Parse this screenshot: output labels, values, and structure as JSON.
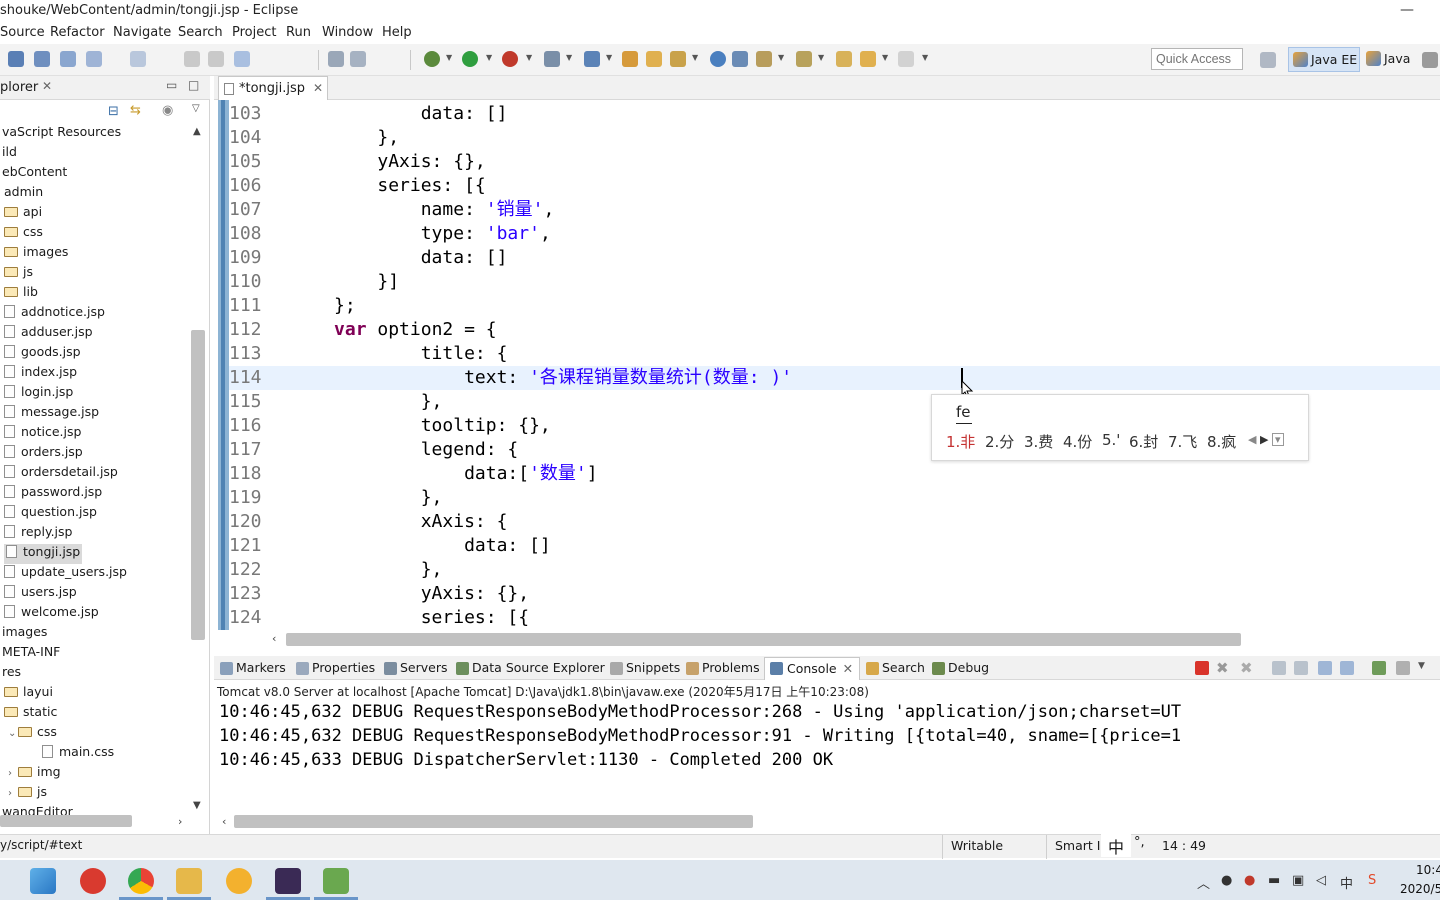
{
  "window": {
    "title": "shouke/WebContent/admin/tongji.jsp - Eclipse",
    "minimize": "—"
  },
  "menu": [
    "Source",
    "Refactor",
    "Navigate",
    "Search",
    "Project",
    "Run",
    "Window",
    "Help"
  ],
  "toolbar": {
    "quick_access_placeholder": "Quick Access",
    "perspective_javaee": "Java EE",
    "perspective_java": "Java"
  },
  "explorer": {
    "tab_label": "plorer",
    "items": [
      {
        "label": "vaScript Resources",
        "kind": "plain"
      },
      {
        "label": "ild",
        "kind": "plain"
      },
      {
        "label": "ebContent",
        "kind": "plain"
      },
      {
        "label": "admin",
        "kind": "plain"
      },
      {
        "label": "api",
        "kind": "folder"
      },
      {
        "label": "css",
        "kind": "folder"
      },
      {
        "label": "images",
        "kind": "folder"
      },
      {
        "label": "js",
        "kind": "folder"
      },
      {
        "label": "lib",
        "kind": "folder"
      },
      {
        "label": "addnotice.jsp",
        "kind": "file"
      },
      {
        "label": "adduser.jsp",
        "kind": "file"
      },
      {
        "label": "goods.jsp",
        "kind": "file"
      },
      {
        "label": "index.jsp",
        "kind": "file"
      },
      {
        "label": "login.jsp",
        "kind": "file"
      },
      {
        "label": "message.jsp",
        "kind": "file"
      },
      {
        "label": "notice.jsp",
        "kind": "file"
      },
      {
        "label": "orders.jsp",
        "kind": "file"
      },
      {
        "label": "ordersdetail.jsp",
        "kind": "file"
      },
      {
        "label": "password.jsp",
        "kind": "file"
      },
      {
        "label": "question.jsp",
        "kind": "file"
      },
      {
        "label": "reply.jsp",
        "kind": "file"
      },
      {
        "label": "tongji.jsp",
        "kind": "file",
        "selected": true
      },
      {
        "label": "update_users.jsp",
        "kind": "file"
      },
      {
        "label": "users.jsp",
        "kind": "file"
      },
      {
        "label": "welcome.jsp",
        "kind": "file"
      },
      {
        "label": "images",
        "kind": "plain"
      },
      {
        "label": "META-INF",
        "kind": "plain"
      },
      {
        "label": "res",
        "kind": "plain"
      },
      {
        "label": "layui",
        "kind": "folder"
      },
      {
        "label": "static",
        "kind": "folder"
      },
      {
        "label": "css",
        "kind": "folder-open"
      },
      {
        "label": "main.css",
        "kind": "file"
      },
      {
        "label": "img",
        "kind": "folder-closed"
      },
      {
        "label": "js",
        "kind": "folder-closed"
      },
      {
        "label": "wangEditor",
        "kind": "plain"
      }
    ]
  },
  "editor": {
    "tab_label": "*tongji.jsp",
    "lines": [
      {
        "n": "103",
        "html": "              data: []"
      },
      {
        "n": "104",
        "html": "          },"
      },
      {
        "n": "105",
        "html": "          yAxis: {},"
      },
      {
        "n": "106",
        "html": "          series: [{"
      },
      {
        "n": "107",
        "html": "              name: '销量',"
      },
      {
        "n": "108",
        "html": "              type: 'bar',"
      },
      {
        "n": "109",
        "html": "              data: []"
      },
      {
        "n": "110",
        "html": "          }]"
      },
      {
        "n": "111",
        "html": "      };"
      },
      {
        "n": "112",
        "html": "      var option2 = {"
      },
      {
        "n": "113",
        "html": "              title: {"
      },
      {
        "n": "114",
        "html": "                  text: '各课程销量数量统计(数量: )'"
      },
      {
        "n": "115",
        "html": "              },"
      },
      {
        "n": "116",
        "html": "              tooltip: {},"
      },
      {
        "n": "117",
        "html": "              legend: {"
      },
      {
        "n": "118",
        "html": "                  data:['数量']"
      },
      {
        "n": "119",
        "html": "              },"
      },
      {
        "n": "120",
        "html": "              xAxis: {"
      },
      {
        "n": "121",
        "html": "                  data: []"
      },
      {
        "n": "122",
        "html": "              },"
      },
      {
        "n": "123",
        "html": "              yAxis: {},"
      },
      {
        "n": "124",
        "html": "              series: [{"
      }
    ]
  },
  "ime": {
    "composition": "fe",
    "candidates": [
      "1.非",
      "2.分",
      "3.费",
      "4.份",
      "5.'",
      "6.封",
      "7.飞",
      "8.疯"
    ]
  },
  "bottom_panel": {
    "tabs": [
      "Markers",
      "Properties",
      "Servers",
      "Data Source Explorer",
      "Snippets",
      "Problems",
      "Console",
      "Search",
      "Debug"
    ],
    "active_tab": "Console",
    "console_desc": "Tomcat v8.0 Server at localhost [Apache Tomcat] D:\\Java\\jdk1.8\\bin\\javaw.exe (2020年5月17日 上午10:23:08)",
    "log": [
      "10:46:45,632 DEBUG RequestResponseBodyMethodProcessor:268 - Using 'application/json;charset=UT",
      "10:46:45,632 DEBUG RequestResponseBodyMethodProcessor:91 - Writing [{total=40, sname=[{price=1",
      "10:46:45,633 DEBUG DispatcherServlet:1130 - Completed 200 OK"
    ]
  },
  "statusbar": {
    "path": "y/script/#text",
    "writable": "Writable",
    "insert_mode": "Smart In",
    "ime_mode": "中",
    "ime_punct": "°,",
    "position": "14 : 49"
  },
  "taskbar": {
    "time": "10:4",
    "date": "2020/5"
  }
}
